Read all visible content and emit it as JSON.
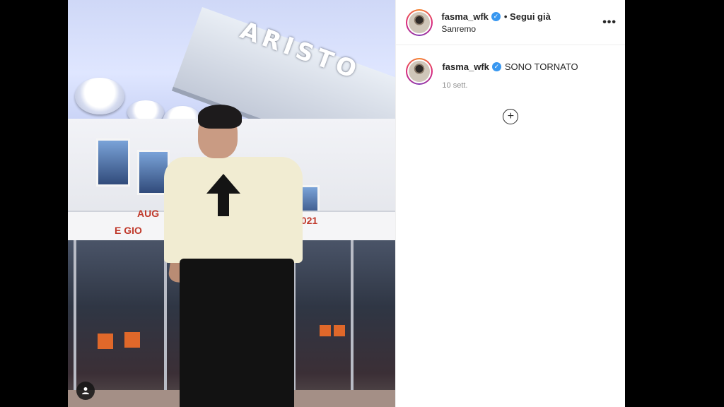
{
  "post": {
    "username": "fasma_wfk",
    "follow_label": "• Segui già",
    "location": "Sanremo",
    "more_options_icon": "more-horizontal-icon",
    "caption": "SONO TORNATO",
    "time_ago": "10 sett.",
    "add_comment_icon": "plus-circle-icon",
    "verified_icon": "verified-badge-icon",
    "user_tag_icon": "user-tag-icon"
  },
  "photo": {
    "sign_text": "ARISTO",
    "banner_left": "AUG",
    "banner_mid": "E GIO",
    "banner_year": "2021"
  },
  "colors": {
    "verified": "#3897f0",
    "text": "#262626",
    "muted": "#8e8e8e"
  }
}
